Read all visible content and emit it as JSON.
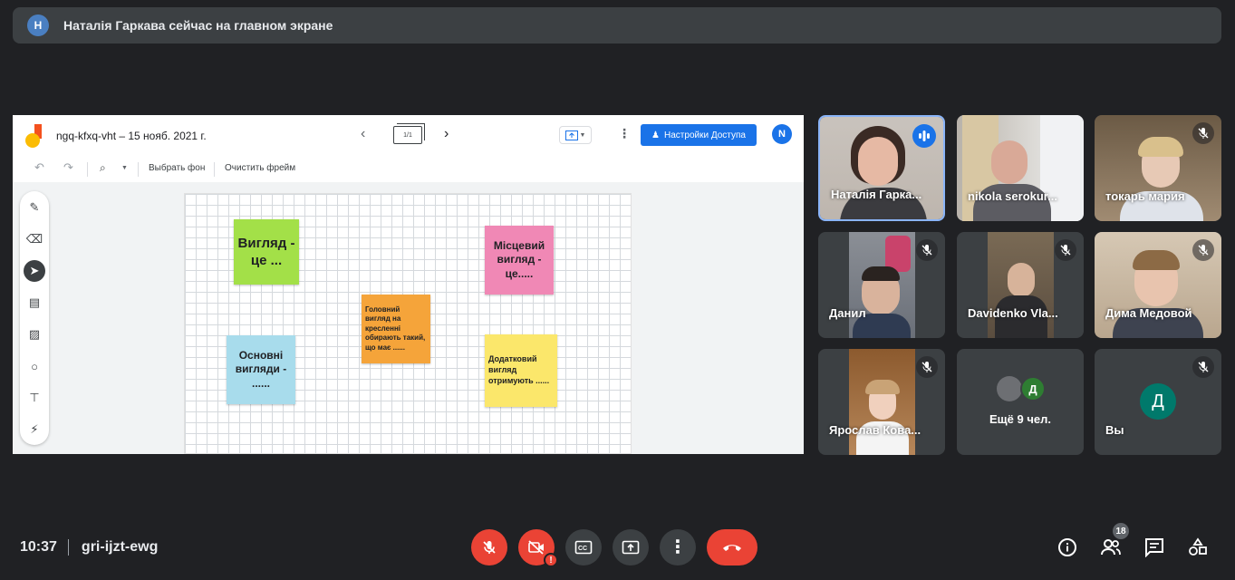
{
  "banner": {
    "avatar_letter": "Н",
    "text": "Наталія Гаркава сейчас на главном экране"
  },
  "jamboard": {
    "title": "ngq-kfxq-vht – 15 нояб. 2021 г.",
    "frame_counter": "1/1",
    "share_button": "Настройки Доступа",
    "user_letter": "N",
    "toolbar": {
      "set_background": "Выбрать фон",
      "clear_frame": "Очистить фрейм"
    },
    "stickies": [
      {
        "text": "Вигляд - це ...",
        "color": "#a3e048"
      },
      {
        "text": "Місцевий вигляд - це.....",
        "color": "#f088b5"
      },
      {
        "text": "Головний вигляд на кресленні обирають такий, що має ......",
        "color": "#f5a43a"
      },
      {
        "text": "Основні вигляди - ......",
        "color": "#a8dcec"
      },
      {
        "text": "Додатковий вигляд отримують ......",
        "color": "#fbe76b"
      }
    ]
  },
  "participants": [
    {
      "name": "Наталія Гаркава",
      "display": "Наталія Гарка...",
      "speaking": true
    },
    {
      "name": "nikola serokurov",
      "display": "nikola serokur...",
      "muted": false
    },
    {
      "name": "токарь мария",
      "display": "токарь мария",
      "muted": true
    },
    {
      "name": "Данил",
      "display": "Данил",
      "muted": true
    },
    {
      "name": "Davidenko Vlad",
      "display": "Davidenko Vla...",
      "muted": true
    },
    {
      "name": "Дима Медовой",
      "display": "Дима Медовой",
      "muted": true
    },
    {
      "name": "Ярослав Коваль",
      "display": "Ярослав Кова...",
      "muted": true
    },
    {
      "name": "others",
      "display": "Ещё 9 чел.",
      "avatar_letter": "Д"
    },
    {
      "name": "you",
      "display": "Вы",
      "avatar_letter": "Д",
      "muted": true
    }
  ],
  "bottom": {
    "time": "10:37",
    "meeting_code": "gri-ijzt-ewg",
    "participants_count": "18"
  },
  "colors": {
    "background": "#202124",
    "danger": "#ea4335",
    "accent": "#1a73e8"
  }
}
